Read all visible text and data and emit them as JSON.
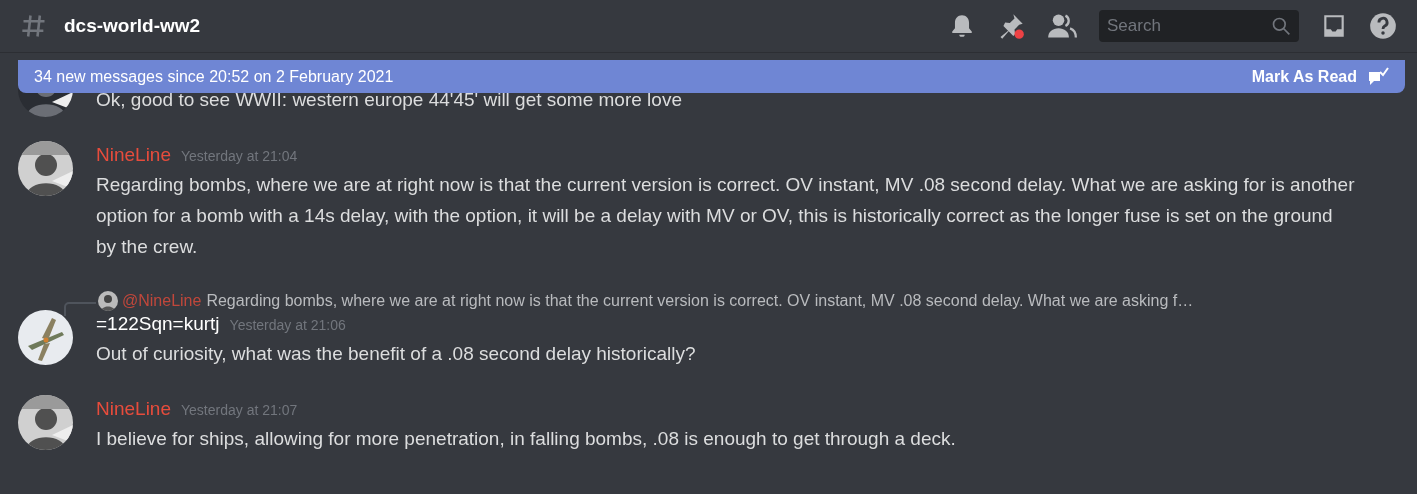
{
  "channel": {
    "name": "dcs-world-ww2"
  },
  "toolbar": {
    "pins_unread": true,
    "search": {
      "placeholder": "Search"
    }
  },
  "new_messages_bar": {
    "text": "34 new messages since 20:52 on 2 February 2021",
    "action": "Mark As Read"
  },
  "messages": [
    {
      "kind": "continuation",
      "text": "Ok, good to see WWII: western europe 44'45' will get some more love"
    },
    {
      "kind": "full",
      "author": "NineLine",
      "color": "#e74c3c",
      "timestamp": "Yesterday at 21:04",
      "text": "Regarding bombs, where we are at right now is that the current version is correct. OV instant, MV .08 second delay. What we are asking for is another option for a bomb with a 14s delay, with the option, it will be a delay with MV or OV, this is historically correct as the longer fuse is set on the ground by the crew."
    },
    {
      "kind": "full",
      "author": "=122Sqn=kurtj",
      "color": "#ffffff",
      "timestamp": "Yesterday at 21:06",
      "reply": {
        "author": "@NineLine",
        "color": "#c0473b",
        "text": "Regarding bombs, where we are at right now is that the current version is correct. OV instant, MV .08 second delay. What we are asking f…"
      },
      "text": "Out of curiosity, what was the benefit of a .08 second delay historically?"
    },
    {
      "kind": "full",
      "author": "NineLine",
      "color": "#e74c3c",
      "timestamp": "Yesterday at 21:07",
      "text": "I believe for ships, allowing for more penetration, in falling bombs, .08 is enough to get through a deck."
    }
  ]
}
